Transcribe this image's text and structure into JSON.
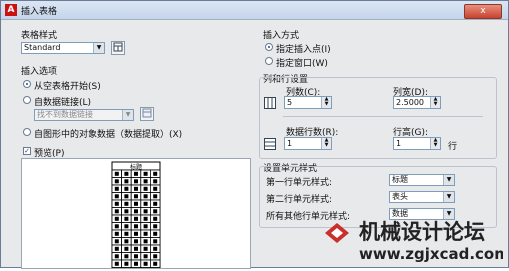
{
  "window": {
    "title": "插入表格",
    "close_glyph": "x"
  },
  "table_style": {
    "label": "表格样式",
    "value": "Standard"
  },
  "insert_options": {
    "label": "插入选项",
    "from_empty": "从空表格开始(S)",
    "from_link": "自数据链接(L)",
    "link_placeholder": "找不到数据链接",
    "from_drawing": "自图形中的对象数据（数据提取）(X)"
  },
  "preview": {
    "label": "预览(P)",
    "header_text": "标题"
  },
  "insert_method": {
    "label": "插入方式",
    "point": "指定插入点(I)",
    "window": "指定窗口(W)"
  },
  "row_col": {
    "label": "列和行设置",
    "columns_label": "列数(C):",
    "columns_value": "5",
    "col_width_label": "列宽(D):",
    "col_width_value": "2.5000",
    "data_rows_label": "数据行数(R):",
    "data_rows_value": "1",
    "row_height_label": "行高(G):",
    "row_height_value": "1",
    "row_unit": "行"
  },
  "cell_styles": {
    "label": "设置单元样式",
    "first_row_label": "第一行单元样式:",
    "first_row_value": "标题",
    "second_row_label": "第二行单元样式:",
    "second_row_value": "表头",
    "other_rows_label": "所有其他行单元样式:",
    "other_rows_value": "数据"
  },
  "watermark": {
    "text": "机械设计论坛",
    "url": "www.zgjxcad.com"
  }
}
